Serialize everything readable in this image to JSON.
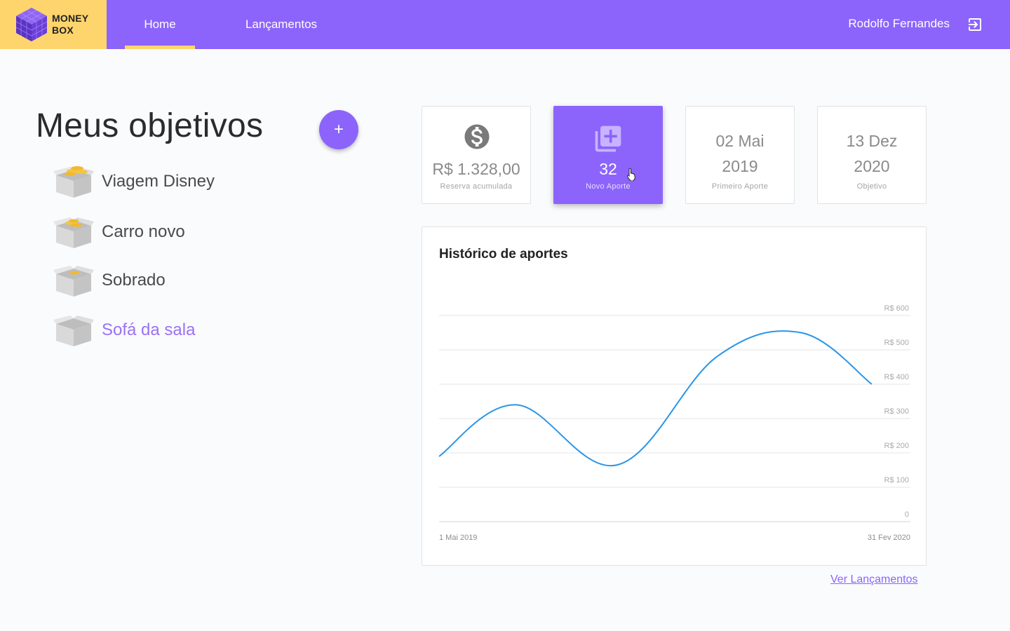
{
  "brand": {
    "line1": "MONEY",
    "line2": "BOX"
  },
  "nav": {
    "tabs": [
      {
        "label": "Home"
      },
      {
        "label": "Lançamentos"
      }
    ]
  },
  "user": {
    "name": "Rodolfo Fernandes"
  },
  "goals": {
    "title": "Meus objetivos",
    "add_label": "+",
    "items": [
      {
        "label": "Viagem Disney"
      },
      {
        "label": "Carro novo"
      },
      {
        "label": "Sobrado"
      },
      {
        "label": "Sofá da sala",
        "active": true
      }
    ]
  },
  "stats": {
    "reserva": {
      "value": "R$ 1.328,00",
      "label": "Reserva acumulada"
    },
    "aporte": {
      "value": "32",
      "label": "Novo Aporte"
    },
    "primeiro": {
      "line1": "02 Mai",
      "line2": "2019",
      "label": "Primeiro Aporte"
    },
    "objetivo": {
      "line1": "13 Dez",
      "line2": "2020",
      "label": "Objetivo"
    }
  },
  "chart_data": {
    "type": "line",
    "title": "Histórico de aportes",
    "x_start_label": "1 Mai 2019",
    "x_end_label": "31 Fev 2020",
    "y_ticks": [
      "0",
      "R$ 100",
      "R$ 200",
      "R$ 300",
      "R$ 400",
      "R$ 500",
      "R$ 600"
    ],
    "ylim": [
      0,
      600
    ],
    "series": [
      {
        "values": [
          190,
          340,
          165,
          480,
          550,
          400
        ]
      }
    ],
    "color": "#2a95e8",
    "grid": true
  },
  "footer": {
    "link": "Ver Lançamentos"
  },
  "colors": {
    "primary": "#8c64fb",
    "accent": "#fdd56c",
    "line": "#2a95e8"
  }
}
